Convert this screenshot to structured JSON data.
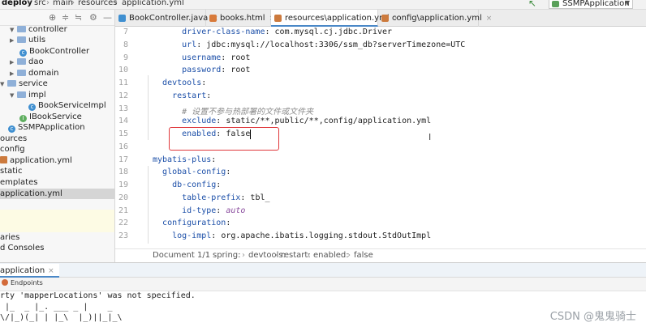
{
  "breadcrumb": {
    "project": "deploy",
    "items": [
      "src",
      "main",
      "resources",
      "application.yml"
    ]
  },
  "run_config": {
    "name": "SSMPApplication"
  },
  "project_tree": [
    {
      "label": "controller",
      "kind": "folder",
      "arrow": "open"
    },
    {
      "label": "utils",
      "kind": "folder",
      "arrow": "closed"
    },
    {
      "label": "BookController",
      "kind": "class"
    },
    {
      "label": "dao",
      "kind": "folder",
      "arrow": "closed"
    },
    {
      "label": "domain",
      "kind": "folder",
      "arrow": "closed"
    },
    {
      "label": "service",
      "kind": "folder",
      "arrow": "open"
    },
    {
      "label": "impl",
      "kind": "folder",
      "arrow": "open"
    },
    {
      "label": "BookServiceImpl",
      "kind": "class"
    },
    {
      "label": "IBookService",
      "kind": "interface"
    },
    {
      "label": "SSMPApplication",
      "kind": "class"
    },
    {
      "label": "ources",
      "kind": "plain"
    },
    {
      "label": "config",
      "kind": "plain"
    },
    {
      "label": "application.yml",
      "kind": "yml"
    },
    {
      "label": "static",
      "kind": "plain"
    },
    {
      "label": "emplates",
      "kind": "plain"
    },
    {
      "label": "application.yml",
      "kind": "plain",
      "selected": true
    }
  ],
  "side_labels": {
    "libraries": "aries",
    "consoles": "d Consoles"
  },
  "tabs": [
    {
      "label": "BookController.java",
      "color": "#3f8fd0"
    },
    {
      "label": "books.html",
      "color": "#d87a3a"
    },
    {
      "label": "resources\\application.yml",
      "color": "#cc7a3d",
      "active": true
    },
    {
      "label": "config\\application.yml",
      "color": "#cc7a3d"
    }
  ],
  "code": {
    "line_numbers": [
      "7",
      "8",
      "9",
      "10",
      "11",
      "12",
      "13",
      "14",
      "15",
      "16",
      "17",
      "18",
      "19",
      "20",
      "21",
      "22",
      "23"
    ],
    "lines": [
      {
        "indent": "      ",
        "key": "driver-class-name",
        "value": "com.mysql.cj.jdbc.Driver"
      },
      {
        "indent": "      ",
        "key": "url",
        "value": "jdbc:mysql://localhost:3306/ssm_db?serverTimezone=UTC"
      },
      {
        "indent": "      ",
        "key": "username",
        "value": "root"
      },
      {
        "indent": "      ",
        "key": "password",
        "value": "root"
      },
      {
        "indent": "  ",
        "key": "devtools",
        "value": ""
      },
      {
        "indent": "    ",
        "key": "restart",
        "value": ""
      },
      {
        "indent": "      ",
        "comment": "# 设置不参与热部署的文件或文件夹"
      },
      {
        "indent": "      ",
        "key": "exclude",
        "value": "static/**,public/**,config/application.yml"
      },
      {
        "indent": "      ",
        "key": "enabled",
        "value": "false"
      },
      {
        "indent": "",
        "key": "",
        "value": ""
      },
      {
        "indent": "",
        "key": "mybatis-plus",
        "value": ""
      },
      {
        "indent": "  ",
        "key": "global-config",
        "value": ""
      },
      {
        "indent": "    ",
        "key": "db-config",
        "value": ""
      },
      {
        "indent": "      ",
        "key": "table-prefix",
        "value": "tbl_"
      },
      {
        "indent": "      ",
        "key": "id-type",
        "value": "auto",
        "style": "italic"
      },
      {
        "indent": "  ",
        "key": "configuration",
        "value": ""
      },
      {
        "indent": "    ",
        "key": "log-impl",
        "value": "org.apache.ibatis.logging.stdout.StdOutImpl"
      }
    ]
  },
  "editor_breadcrumb": [
    "Document 1/1",
    "spring:",
    "devtools:",
    "restart:",
    "enabled:",
    "false"
  ],
  "run_panel": {
    "tab": "application",
    "endpoints": "Endpoints",
    "console_lines": [
      "rty 'mapperLocations' was not specified.",
      " |_  _ |_. ___ _ |    _",
      "\\/|_)(_| | |_\\  |_)||_|_\\"
    ]
  },
  "watermark": "CSDN @鬼鬼骑士",
  "colors": {
    "accent": "#4a88c7",
    "key": "#1c4fa8",
    "highlight_box": "#e0373b"
  }
}
